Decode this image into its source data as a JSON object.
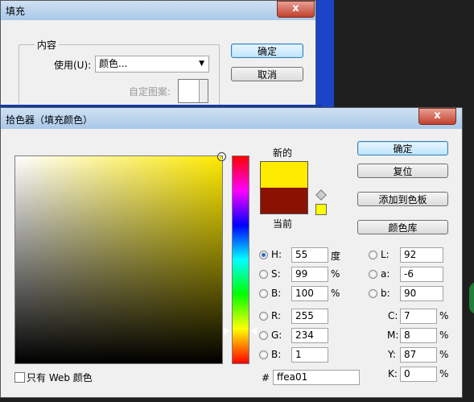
{
  "fill_dialog": {
    "title": "填充",
    "close": "x",
    "group_label": "内容",
    "use_label": "使用(U):",
    "use_value": "颜色...",
    "custom_pattern_label": "自定图案:",
    "ok": "确定",
    "cancel": "取消"
  },
  "color_picker": {
    "title": "拾色器（填充颜色）",
    "close": "x",
    "new_label": "新的",
    "current_label": "当前",
    "new_color": "#ffea01",
    "current_color": "#8b1200",
    "buttons": {
      "ok": "确定",
      "reset": "复位",
      "add_to_swatches": "添加到色板",
      "color_libraries": "颜色库"
    },
    "hsb": [
      {
        "key": "H:",
        "value": "55",
        "unit": "度",
        "selected": true
      },
      {
        "key": "S:",
        "value": "99",
        "unit": "%",
        "selected": false
      },
      {
        "key": "B:",
        "value": "100",
        "unit": "%",
        "selected": false
      }
    ],
    "rgb": [
      {
        "key": "R:",
        "value": "255"
      },
      {
        "key": "G:",
        "value": "234"
      },
      {
        "key": "B:",
        "value": "1"
      }
    ],
    "lab": [
      {
        "key": "L:",
        "value": "92"
      },
      {
        "key": "a:",
        "value": "-6"
      },
      {
        "key": "b:",
        "value": "90"
      }
    ],
    "cmyk": [
      {
        "key": "C:",
        "value": "7",
        "unit": "%"
      },
      {
        "key": "M:",
        "value": "8",
        "unit": "%"
      },
      {
        "key": "Y:",
        "value": "87",
        "unit": "%"
      },
      {
        "key": "K:",
        "value": "0",
        "unit": "%"
      }
    ],
    "hex_label": "#",
    "hex_value": "ffea01",
    "web_only_label": "只有 Web 颜色",
    "hue_color": "#ffea00"
  }
}
